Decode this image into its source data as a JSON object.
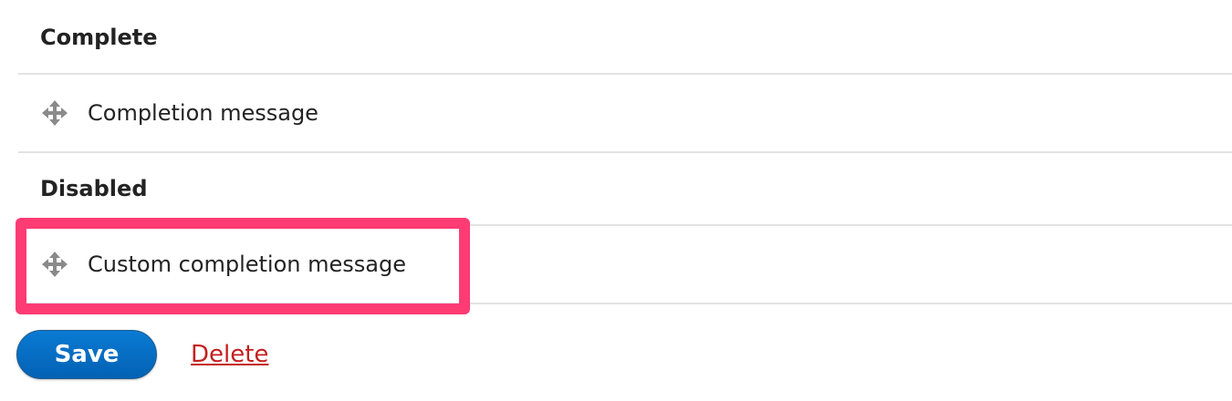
{
  "regions": [
    {
      "title": "Complete",
      "items": [
        {
          "label": "Completion message",
          "icon": "drag-handle-icon"
        }
      ]
    },
    {
      "title": "Disabled",
      "items": [
        {
          "label": "Custom completion message",
          "icon": "drag-handle-icon"
        }
      ]
    }
  ],
  "actions": {
    "save_label": "Save",
    "delete_label": "Delete"
  },
  "colors": {
    "highlight": "#ff3b74",
    "primary_button": "#0a73c8",
    "delete_link": "#c41f1f",
    "divider": "#e2e2e2"
  }
}
